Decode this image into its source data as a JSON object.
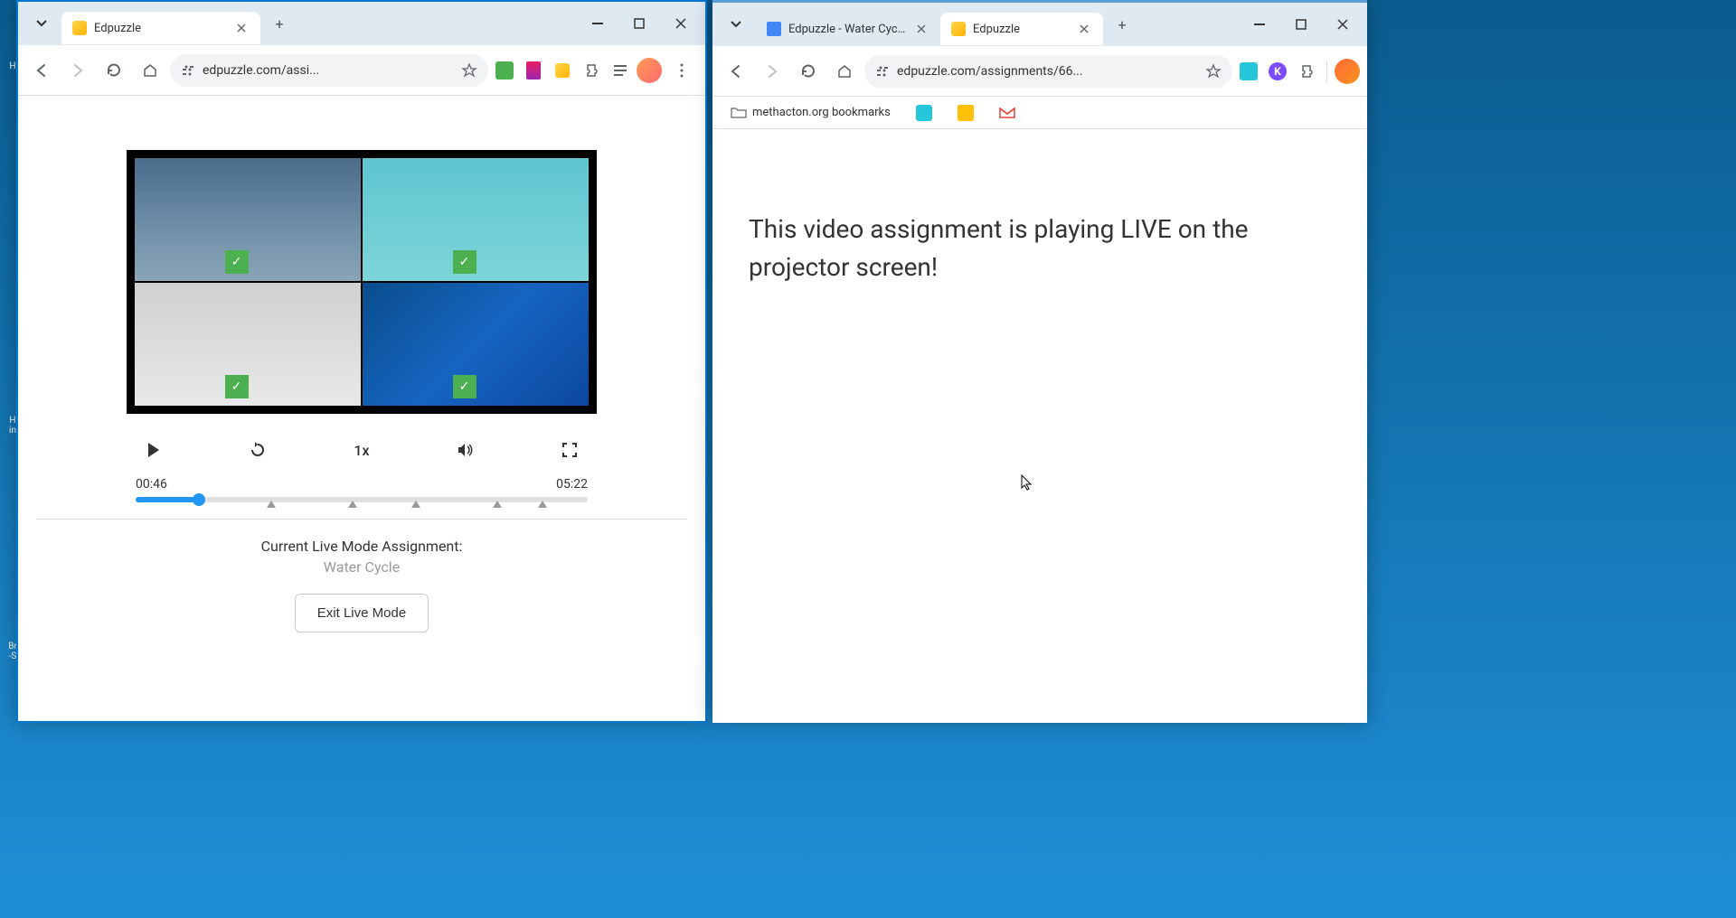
{
  "left_window": {
    "tabs": [
      {
        "title": "Edpuzzle"
      }
    ],
    "url": "edpuzzle.com/assi...",
    "video": {
      "current_time": "00:46",
      "total_time": "05:22",
      "speed": "1x",
      "progress_percent": 14,
      "marker_positions": [
        29,
        47,
        61,
        79,
        89
      ]
    },
    "assignment": {
      "label": "Current Live Mode Assignment:",
      "name": "Water Cycle",
      "exit_button": "Exit Live Mode"
    }
  },
  "right_window": {
    "tabs": [
      {
        "title": "Edpuzzle - Water Cycle",
        "active": false
      },
      {
        "title": "Edpuzzle",
        "active": true
      }
    ],
    "url": "edpuzzle.com/assignments/66...",
    "bookmarks": {
      "folder": "methacton.org bookmarks"
    },
    "message": "This video assignment is playing LIVE on the projector screen!"
  }
}
